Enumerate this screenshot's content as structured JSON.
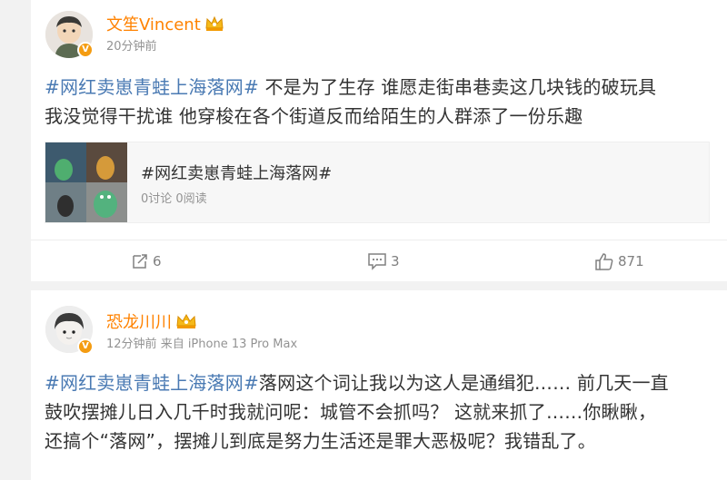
{
  "posts": [
    {
      "author": "文笙Vincent",
      "time": "20分钟前",
      "source": "",
      "hashtag": "#网红卖崽青蛙上海落网#",
      "text_line1": " 不是为了生存 谁愿走街串巷卖这几块钱的破玩具",
      "text_line2": "我没觉得干扰谁 他穿梭在各个街道反而给陌生的人群添了一份乐趣",
      "topic": {
        "title": "#网红卖崽青蛙上海落网#",
        "stats": "0讨论 0阅读"
      },
      "actions": {
        "repost_count": "6",
        "comment_count": "3",
        "like_count": "871"
      }
    },
    {
      "author": "恐龙川川",
      "time": "12分钟前",
      "source": "来自 iPhone 13 Pro Max",
      "hashtag": "#网红卖崽青蛙上海落网#",
      "text_line1": "落网这个词让我以为这人是通缉犯…… 前几天一直",
      "text_line2": "鼓吹摆摊儿日入几千时我就问呢：城管不会抓吗？ 这就来抓了……你瞅瞅，",
      "text_line3": "还搞个“落网”，摆摊儿到底是努力生活还是罪大恶极呢？我错乱了。"
    }
  ],
  "colors": {
    "username": "#ff8200",
    "hashtag": "#4a7ab3",
    "verified_badge": "#f49c12",
    "meta": "#939393"
  },
  "icons": {
    "verified": "v-badge-icon",
    "crown": "crown-icon",
    "repost": "repost-icon",
    "comment": "comment-icon",
    "like": "thumbs-up-icon"
  }
}
